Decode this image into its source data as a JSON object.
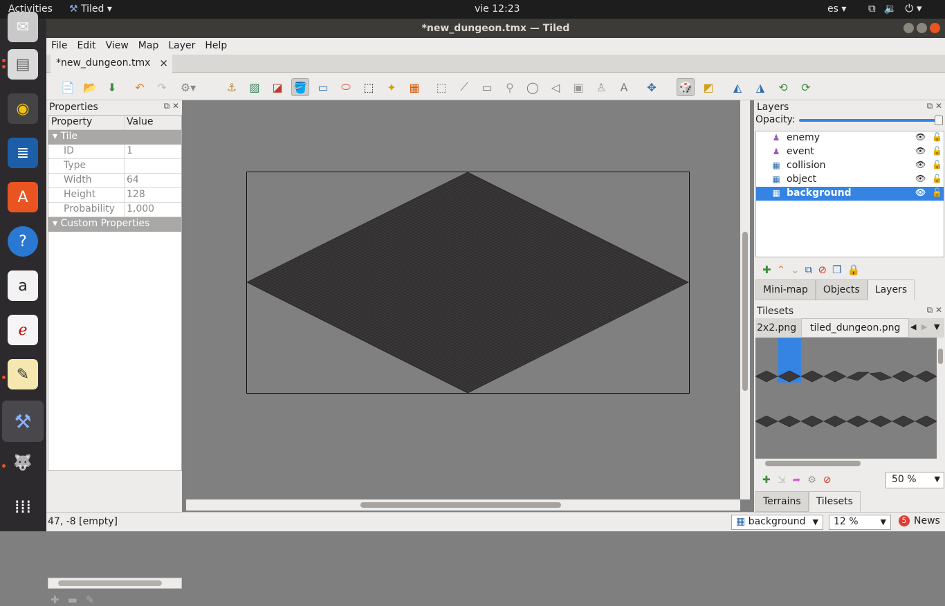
{
  "topbar": {
    "activities": "Activities",
    "app": "Tiled",
    "clock": "vie 12:23",
    "lang": "es"
  },
  "window": {
    "title": "*new_dungeon.tmx — Tiled"
  },
  "menu": [
    "File",
    "Edit",
    "View",
    "Map",
    "Layer",
    "Help"
  ],
  "doc_tab": {
    "label": "*new_dungeon.tmx",
    "close": "×"
  },
  "properties": {
    "title": "Properties",
    "col_property": "Property",
    "col_value": "Value",
    "group_tile": "Tile",
    "rows": [
      {
        "name": "ID",
        "value": "1"
      },
      {
        "name": "Type",
        "value": ""
      },
      {
        "name": "Width",
        "value": "64"
      },
      {
        "name": "Height",
        "value": "128"
      },
      {
        "name": "Probability",
        "value": "1,000"
      }
    ],
    "group_custom": "Custom Properties"
  },
  "layers": {
    "title": "Layers",
    "opacity_label": "Opacity:",
    "opacity": 1.0,
    "items": [
      {
        "name": "enemy",
        "type": "object"
      },
      {
        "name": "event",
        "type": "object"
      },
      {
        "name": "collision",
        "type": "tile"
      },
      {
        "name": "object",
        "type": "tile"
      },
      {
        "name": "background",
        "type": "tile",
        "selected": true
      }
    ],
    "tabs": [
      "Mini-map",
      "Objects",
      "Layers"
    ]
  },
  "tilesets": {
    "title": "Tilesets",
    "tab_partial": "2x2.png",
    "tab_active": "tiled_dungeon.png",
    "zoom": "50 %",
    "tabs": [
      "Terrains",
      "Tilesets"
    ]
  },
  "status": {
    "coords": "47, -8 [empty]",
    "layer": "background",
    "zoom": "12 %",
    "news": "News",
    "news_count": "5"
  },
  "colors": {
    "accent": "#3584e4",
    "canvas": "#808080",
    "tile": "#3a3838"
  }
}
